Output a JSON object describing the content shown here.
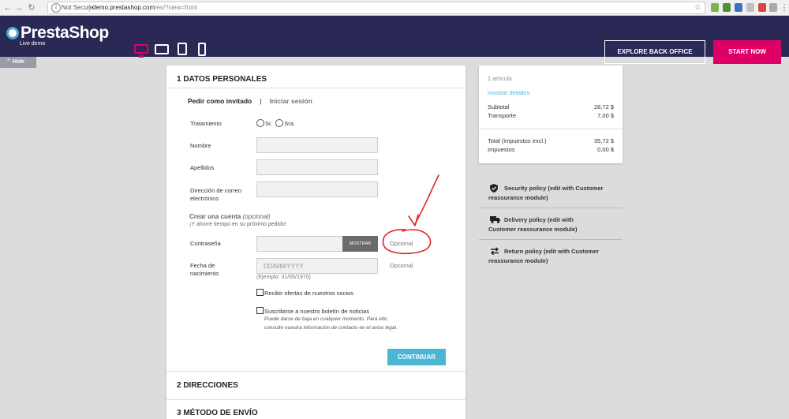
{
  "browser": {
    "security": "Not Secure",
    "url_host": "demo.prestashop.com",
    "url_path": "/es/?view=front"
  },
  "header": {
    "logo_text": "PrestaShop",
    "logo_sub": "Live demo",
    "explore_label": "EXPLORE BACK OFFICE",
    "start_label": "START NOW",
    "accent": "#df0067",
    "bg": "#2a2854"
  },
  "hide_label": "Hide",
  "checkout": {
    "step1": "1   DATOS PERSONALES",
    "tab_guest": "Pedir como invitado",
    "tab_sep": "|",
    "tab_login": "Iniciar sesión",
    "labels": {
      "tratamiento": "Tratamiento",
      "sr": "Sr.",
      "sra": "Sra.",
      "nombre": "Nombre",
      "apellidos": "Apellidos",
      "email_1": "Dirección de correo",
      "email_2": "electrónico",
      "password": "Contraseña",
      "birth_1": "Fecha de",
      "birth_2": "nacimiento"
    },
    "create_title": "Crear una cuenta",
    "create_optional": "(opcional)",
    "create_sub": "¡Y ahorre tiempo en su próximo pedido!",
    "show_label": "MOSTRAR",
    "optional_password": "Opcional",
    "optional_birth": "Opcional",
    "birth_placeholder": "DD/MM/YYYY",
    "birth_hint": "(Ejemplo: 31/05/1970)",
    "offers_label": "Recibir ofertas de nuestros socios",
    "newsletter_label": "Suscribirse a nuestro boletín de noticias",
    "legal_text": "Puede darse de baja en cualquier momento. Para ello, consulte nuestra información de contacto en el aviso legal.",
    "continue_label": "CONTINUAR",
    "continue_color": "#4bb5d4",
    "step2": "2   DIRECCIONES",
    "step3": "3   MÉTODO DE ENVÍO"
  },
  "summary": {
    "items": "1 artículo",
    "details": "mostrar detalles",
    "subtotal_label": "Subtotal",
    "subtotal": "28,72 $",
    "shipping_label": "Transporte",
    "shipping": "7,00 $",
    "total_label": "Total (impuestos excl.)",
    "total": "35,72 $",
    "taxes_label": "Impuestos",
    "taxes": "0,00 $"
  },
  "reassurance": {
    "security_1": "Security policy (edit with Customer",
    "security_2": "reassurance module)",
    "delivery_1": "Delivery policy (edit with",
    "delivery_2": "Customer reassurance module)",
    "return_1": "Return policy (edit with Customer",
    "return_2": "reassurance module)"
  }
}
